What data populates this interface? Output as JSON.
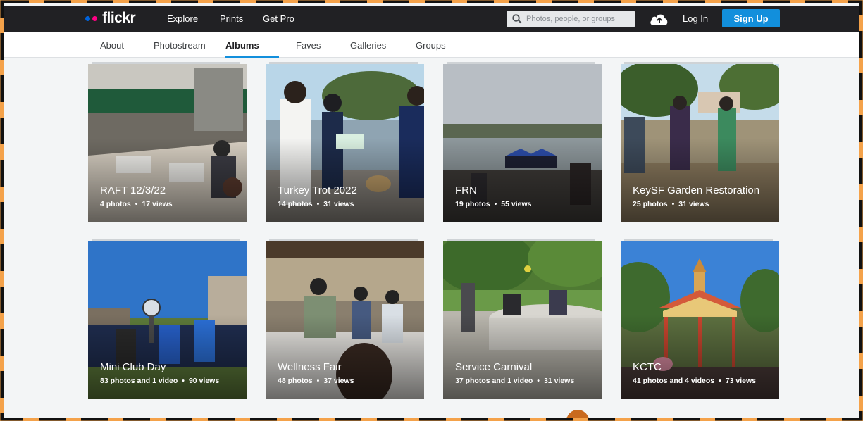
{
  "header": {
    "logo_text": "flickr",
    "logo_colors": [
      "#0063dc",
      "#ff0084"
    ],
    "nav": [
      "Explore",
      "Prints",
      "Get Pro"
    ],
    "search_placeholder": "Photos, people, or groups",
    "login_label": "Log In",
    "signup_label": "Sign Up",
    "signup_color": "#128fdc"
  },
  "subnav": {
    "tabs": [
      "About",
      "Photostream",
      "Albums",
      "Faves",
      "Galleries",
      "Groups"
    ],
    "active_tab": "Albums"
  },
  "albums": [
    {
      "title": "RAFT 12/3/22",
      "photos": "4 photos",
      "views": "17 views"
    },
    {
      "title": "Turkey Trot 2022",
      "photos": "14 photos",
      "views": "31 views"
    },
    {
      "title": "FRN",
      "photos": "19 photos",
      "views": "55 views"
    },
    {
      "title": "KeySF Garden Restoration",
      "photos": "25 photos",
      "views": "31 views"
    },
    {
      "title": "Mini Club Day",
      "photos": "83 photos and 1 video",
      "views": "90 views"
    },
    {
      "title": "Wellness Fair",
      "photos": "48 photos",
      "views": "37 views"
    },
    {
      "title": "Service Carnival",
      "photos": "37 photos and 1 video",
      "views": "31 views"
    },
    {
      "title": "KCTC",
      "photos": "41 photos and 4 videos",
      "views": "73 views"
    }
  ],
  "meta_separator": "•"
}
